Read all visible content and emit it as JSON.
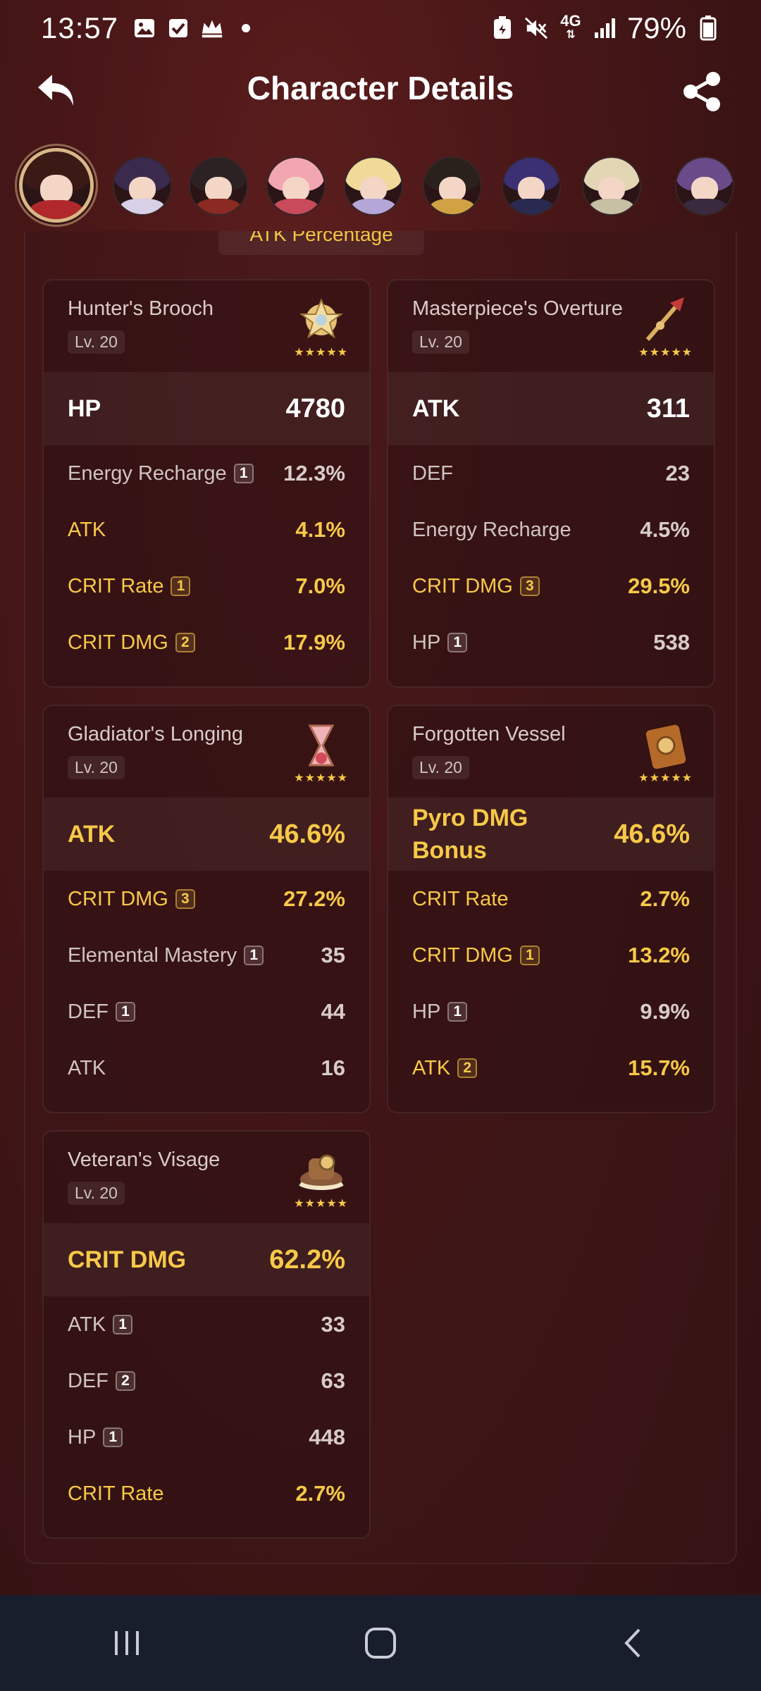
{
  "status_bar": {
    "time": "13:57",
    "battery_percent": "79%",
    "network": "4G",
    "left_icons": [
      "gallery-icon",
      "check-icon",
      "crown-icon",
      "dot-icon"
    ],
    "right_icons": [
      "battery-saver-icon",
      "mute-icon",
      "network-4g-icon",
      "signal-icon",
      "battery-icon"
    ]
  },
  "header": {
    "title": "Character Details",
    "back_icon": "back-arrow-icon",
    "share_icon": "share-icon"
  },
  "avatars": [
    {
      "name": "character-1",
      "active": true,
      "hair": "#3b1a16",
      "body": "#b0282c"
    },
    {
      "name": "character-2",
      "active": false,
      "hair": "#3a2a4e",
      "body": "#d7d0e6"
    },
    {
      "name": "character-3",
      "active": false,
      "hair": "#2c2224",
      "body": "#8a2a22"
    },
    {
      "name": "character-4",
      "active": false,
      "hair": "#f2a6b2",
      "body": "#c94a5a"
    },
    {
      "name": "character-5",
      "active": false,
      "hair": "#f1d99a",
      "body": "#b5a6d8"
    },
    {
      "name": "character-6",
      "active": false,
      "hair": "#2b211c",
      "body": "#d1a244"
    },
    {
      "name": "character-7",
      "active": false,
      "hair": "#3a3072",
      "body": "#2a2a50"
    },
    {
      "name": "character-8",
      "active": false,
      "hair": "#e3d6b4",
      "body": "#c8c0a4"
    },
    {
      "name": "character-9",
      "active": false,
      "hair": "#6b4a8a",
      "body": "#3a2a40"
    }
  ],
  "partial_tab_label": "ATK Percentage",
  "artifacts": [
    {
      "name": "Hunter's Brooch",
      "level": "Lv. 20",
      "icon": "brooch-flower-icon",
      "stars": "★★★★★",
      "main_stat": {
        "label": "HP",
        "value": "4780",
        "highlight": false
      },
      "sub_stats": [
        {
          "label": "Energy Recharge",
          "roll": "1",
          "value": "12.3%",
          "highlight": false
        },
        {
          "label": "ATK",
          "roll": "",
          "value": "4.1%",
          "highlight": true
        },
        {
          "label": "CRIT Rate",
          "roll": "1",
          "value": "7.0%",
          "highlight": true
        },
        {
          "label": "CRIT DMG",
          "roll": "2",
          "value": "17.9%",
          "highlight": true
        }
      ]
    },
    {
      "name": "Masterpiece's Overture",
      "level": "Lv. 20",
      "icon": "quill-plume-icon",
      "stars": "★★★★★",
      "main_stat": {
        "label": "ATK",
        "value": "311",
        "highlight": false
      },
      "sub_stats": [
        {
          "label": "DEF",
          "roll": "",
          "value": "23",
          "highlight": false
        },
        {
          "label": "Energy Recharge",
          "roll": "",
          "value": "4.5%",
          "highlight": false
        },
        {
          "label": "CRIT DMG",
          "roll": "3",
          "value": "29.5%",
          "highlight": true
        },
        {
          "label": "HP",
          "roll": "1",
          "value": "538",
          "highlight": false
        }
      ]
    },
    {
      "name": "Gladiator's Longing",
      "level": "Lv. 20",
      "icon": "hourglass-sands-icon",
      "stars": "★★★★★",
      "main_stat": {
        "label": "ATK",
        "value": "46.6%",
        "highlight": true
      },
      "sub_stats": [
        {
          "label": "CRIT DMG",
          "roll": "3",
          "value": "27.2%",
          "highlight": true
        },
        {
          "label": "Elemental Mastery",
          "roll": "1",
          "value": "35",
          "highlight": false
        },
        {
          "label": "DEF",
          "roll": "1",
          "value": "44",
          "highlight": false
        },
        {
          "label": "ATK",
          "roll": "",
          "value": "16",
          "highlight": false
        }
      ]
    },
    {
      "name": "Forgotten Vessel",
      "level": "Lv. 20",
      "icon": "goblet-book-icon",
      "stars": "★★★★★",
      "main_stat": {
        "label": "Pyro DMG Bonus",
        "value": "46.6%",
        "highlight": true
      },
      "sub_stats": [
        {
          "label": "CRIT Rate",
          "roll": "",
          "value": "2.7%",
          "highlight": true
        },
        {
          "label": "CRIT DMG",
          "roll": "1",
          "value": "13.2%",
          "highlight": true
        },
        {
          "label": "HP",
          "roll": "1",
          "value": "9.9%",
          "highlight": false
        },
        {
          "label": "ATK",
          "roll": "2",
          "value": "15.7%",
          "highlight": true
        }
      ]
    },
    {
      "name": "Veteran's Visage",
      "level": "Lv. 20",
      "icon": "hat-circlet-icon",
      "stars": "★★★★★",
      "main_stat": {
        "label": "CRIT DMG",
        "value": "62.2%",
        "highlight": true
      },
      "sub_stats": [
        {
          "label": "ATK",
          "roll": "1",
          "value": "33",
          "highlight": false
        },
        {
          "label": "DEF",
          "roll": "2",
          "value": "63",
          "highlight": false
        },
        {
          "label": "HP",
          "roll": "1",
          "value": "448",
          "highlight": false
        },
        {
          "label": "CRIT Rate",
          "roll": "",
          "value": "2.7%",
          "highlight": true
        }
      ]
    }
  ],
  "nav_bar": {
    "recents_icon": "recents-icon",
    "home_icon": "home-icon",
    "back_icon": "nav-back-icon"
  }
}
